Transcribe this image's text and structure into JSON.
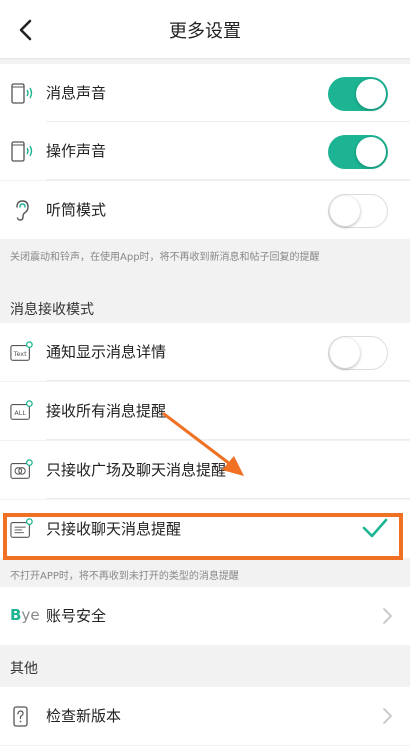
{
  "header": {
    "title": "更多设置"
  },
  "sound": {
    "message_sound": {
      "label": "消息声音",
      "on": true
    },
    "operation_sound": {
      "label": "操作声音",
      "on": true
    },
    "earpiece_mode": {
      "label": "听筒模式",
      "on": false
    },
    "hint": "关闭震动和铃声，在使用App时，将不再收到新消息和帖子回复的提醒"
  },
  "receive_mode": {
    "section_title": "消息接收模式",
    "show_detail": {
      "label": "通知显示消息详情",
      "on": false
    },
    "all": {
      "label": "接收所有消息提醒"
    },
    "plaza_chat": {
      "label": "只接收广场及聊天消息提醒"
    },
    "chat_only": {
      "label": "只接收聊天消息提醒",
      "selected": true
    },
    "hint": "不打开APP时，将不再收到未打开的类型的消息提醒"
  },
  "account": {
    "label": "账号安全",
    "icon_text_b": "B",
    "icon_text_ye": "ye"
  },
  "other": {
    "section_title": "其他",
    "check_update": {
      "label": "检查新版本"
    }
  },
  "icons": {
    "text_badge": "Text",
    "all_badge": "ALL"
  },
  "colors": {
    "accent": "#1cb493",
    "highlight": "#f07124"
  }
}
